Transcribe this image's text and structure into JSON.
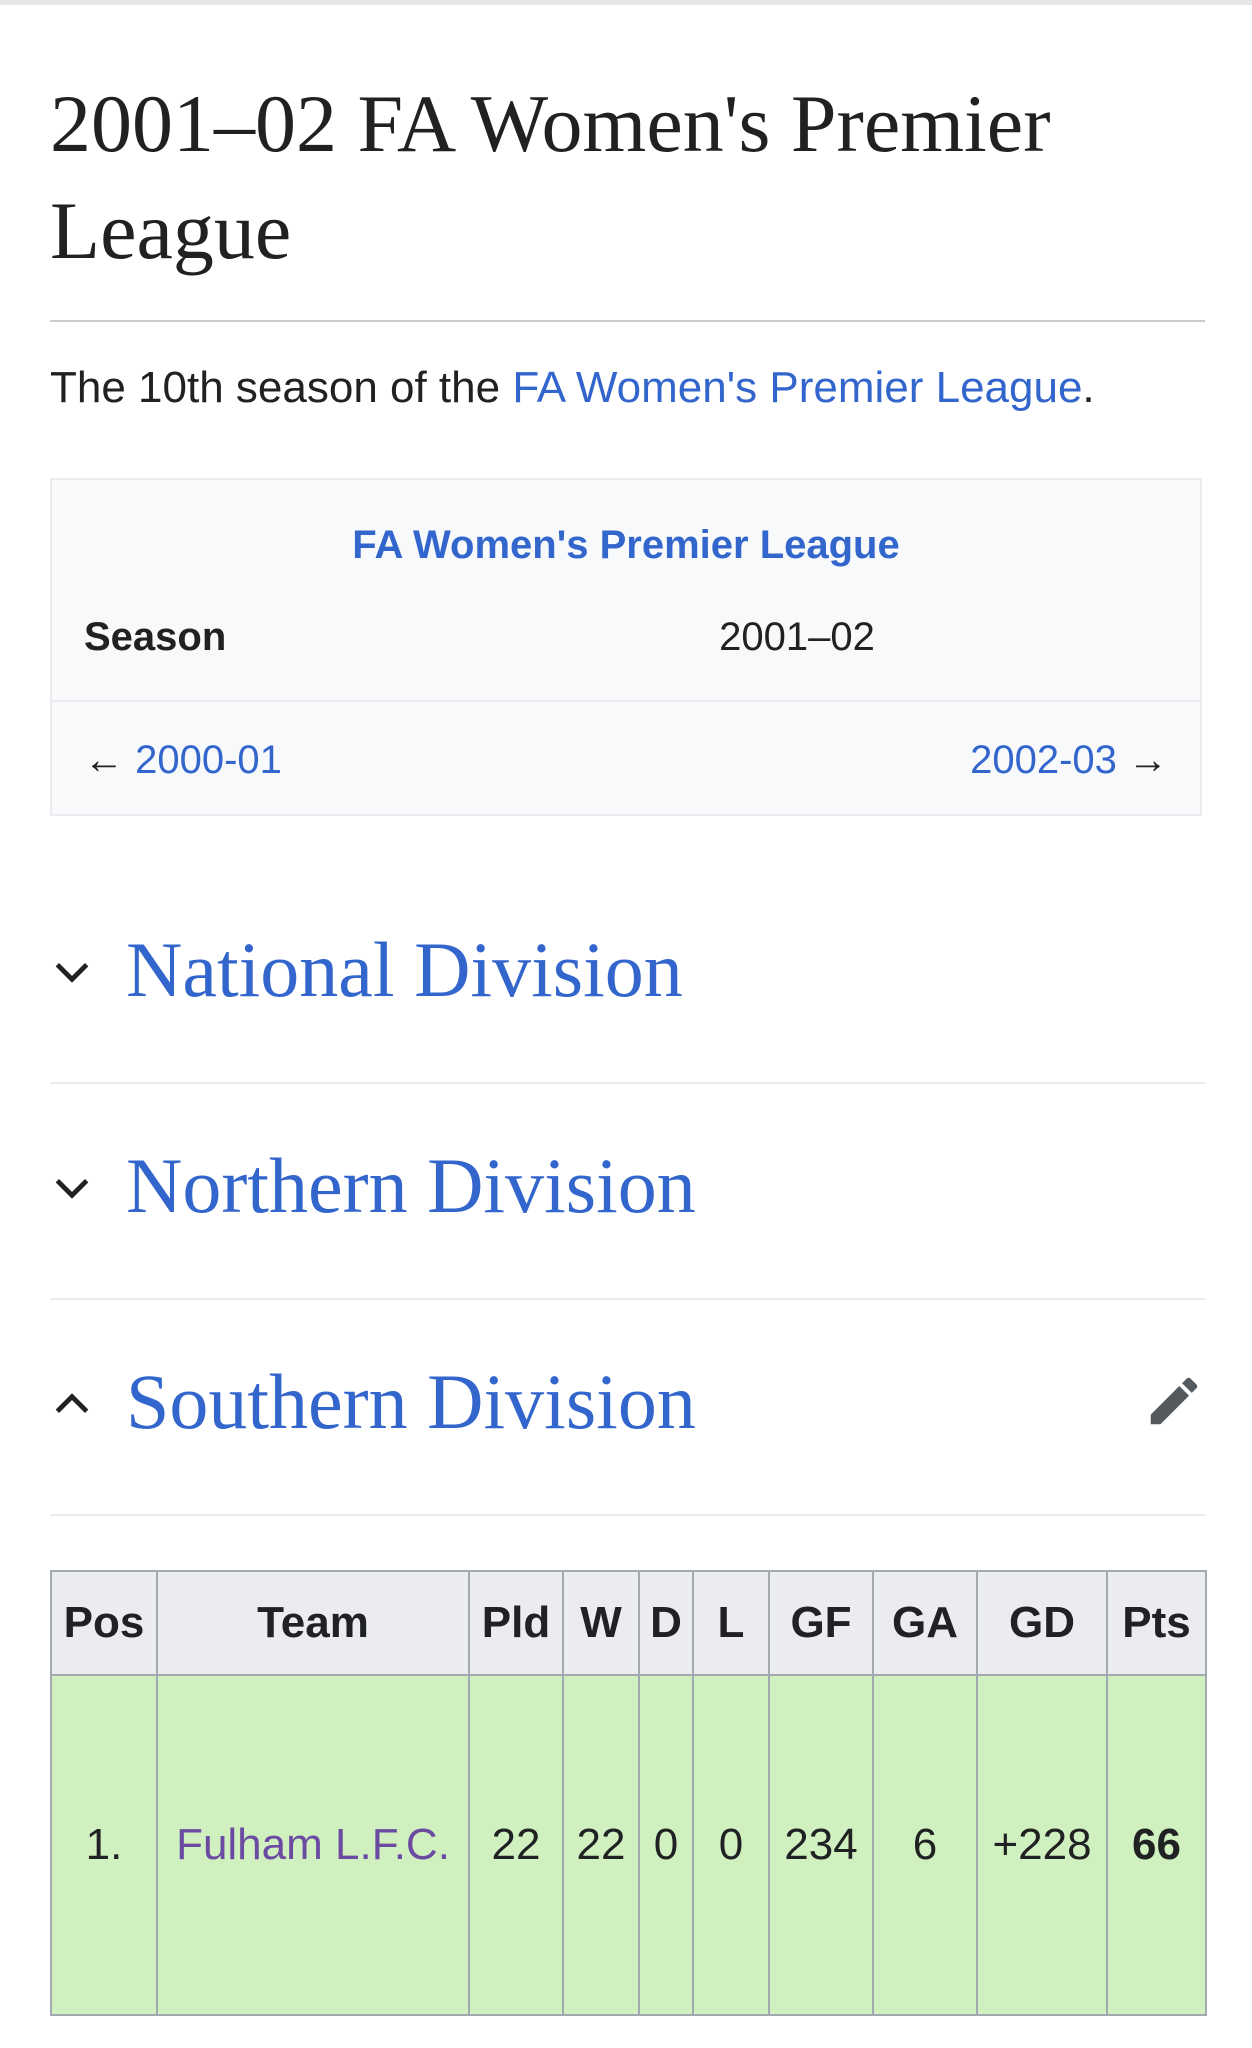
{
  "page": {
    "title": "2001–02 FA Women's Premier League",
    "intro": {
      "before": "The 10th season of the ",
      "link": "FA Women's Premier League",
      "after": "."
    }
  },
  "infobox": {
    "title": "FA Women's Premier League",
    "season_label": "Season",
    "season_value": "2001–02",
    "prev_arrow": "←",
    "prev_label": "2000-01",
    "next_label": "2002-03",
    "next_arrow": "→"
  },
  "sections": [
    {
      "title": "National Division",
      "expanded": false,
      "icon": "chevron-down-icon"
    },
    {
      "title": "Northern Division",
      "expanded": false,
      "icon": "chevron-down-icon"
    },
    {
      "title": "Southern Division",
      "expanded": true,
      "icon": "chevron-up-icon",
      "action_icon": "pencil-edit-icon"
    }
  ],
  "standings": {
    "headers": [
      "Pos",
      "Team",
      "Pld",
      "W",
      "D",
      "L",
      "GF",
      "GA",
      "GD",
      "Pts"
    ],
    "rows": [
      {
        "pos": "1.",
        "team": "Fulham L.F.C.",
        "pld": "22",
        "w": "22",
        "d": "0",
        "l": "0",
        "gf": "234",
        "ga": "6",
        "gd": "+228",
        "pts": "66"
      }
    ]
  },
  "colors": {
    "link": "#3366cc",
    "visited_link": "#6b4ba1",
    "highlight_row": "#d0f0c0",
    "header_bg": "#eaecf0",
    "infobox_bg": "#f8f9fa"
  }
}
